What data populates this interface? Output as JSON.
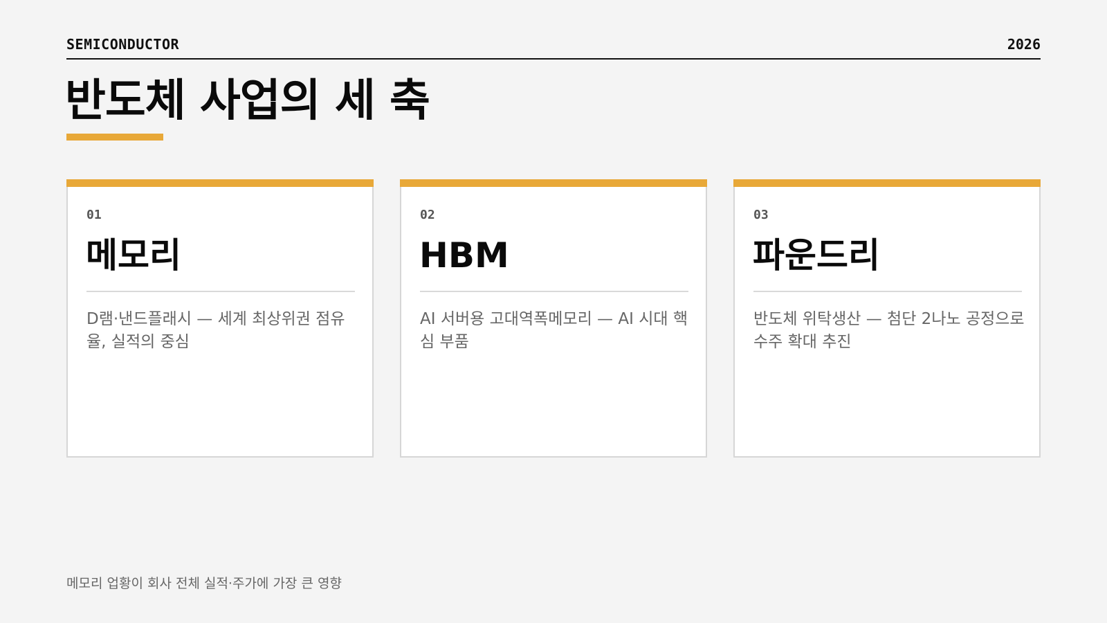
{
  "header": {
    "kicker": "SEMICONDUCTOR",
    "year": "2026"
  },
  "title": "반도체 사업의 세 축",
  "colors": {
    "accent": "#e8a838",
    "background": "#f4f4f4",
    "card": "#ffffff",
    "text": "#111111",
    "muted": "#666666"
  },
  "cards": [
    {
      "number": "01",
      "title": "메모리",
      "description": "D램·낸드플래시 — 세계 최상위권 점유율, 실적의 중심"
    },
    {
      "number": "02",
      "title": "HBM",
      "description": "AI 서버용 고대역폭메모리 — AI 시대 핵심 부품"
    },
    {
      "number": "03",
      "title": "파운드리",
      "description": "반도체 위탁생산 — 첨단 2나노 공정으로 수주 확대 추진"
    }
  ],
  "footer": {
    "note": "메모리 업황이 회사 전체 실적·주가에 가장 큰 영향"
  }
}
